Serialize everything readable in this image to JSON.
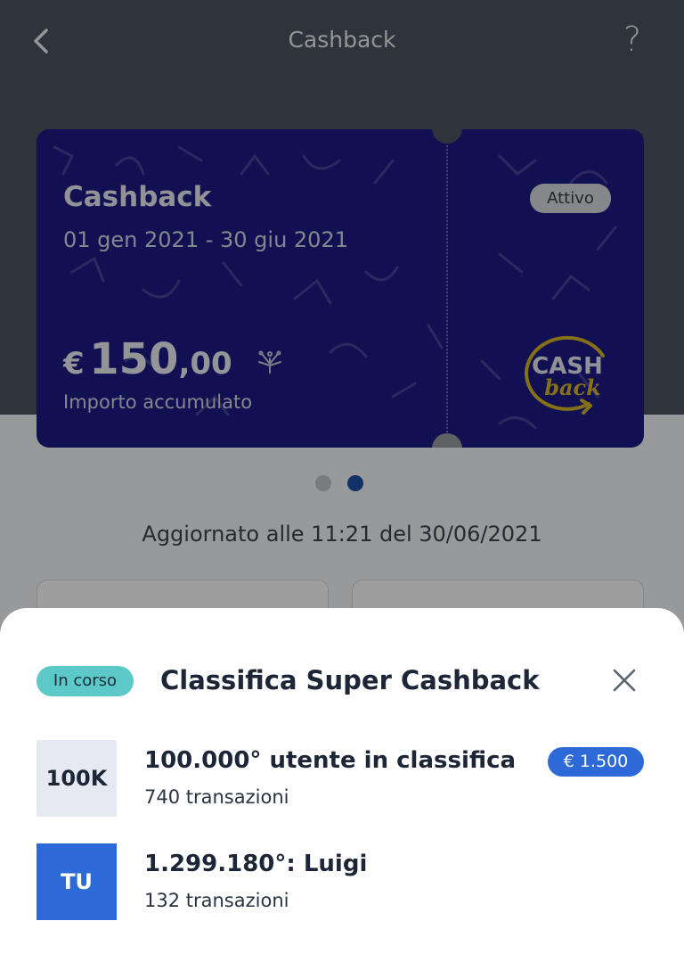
{
  "header": {
    "title": "Cashback",
    "help_label": "?"
  },
  "card": {
    "title": "Cashback",
    "period": "01 gen 2021 - 30 giu 2021",
    "status": "Attivo",
    "currency": "€",
    "amount_int": "150",
    "amount_dec": ",00",
    "amount_label": "Importo accumulato",
    "logo_line1": "CASH",
    "logo_line2": "back"
  },
  "carousel": {
    "page_count": 2,
    "active_index": 1
  },
  "updated_text": "Aggiornato alle 11:21 del 30/06/2021",
  "sheet": {
    "status": "In corso",
    "title": "Classifica Super Cashback",
    "rows": [
      {
        "badge": "100K",
        "title": "100.000° utente in classifica",
        "subtitle": "740 transazioni",
        "prize": "€ 1.500"
      },
      {
        "badge": "TU",
        "title": "1.299.180°: Luigi",
        "subtitle": "132 transazioni"
      }
    ]
  },
  "colors": {
    "card_bg": "#1b1a86",
    "accent_blue": "#2d6ad7",
    "status_teal": "#5cc8c8",
    "logo_gold": "#d9b526"
  }
}
